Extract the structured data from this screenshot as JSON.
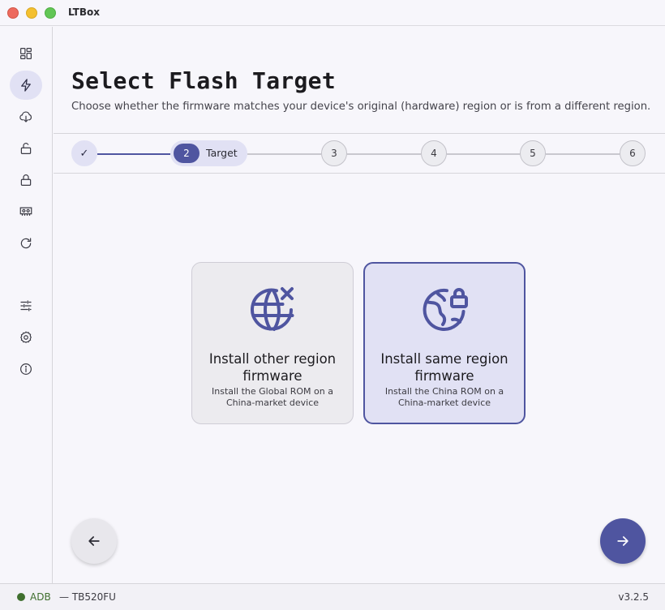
{
  "window": {
    "title": "LTBox"
  },
  "sidebar": {
    "items": [
      {
        "icon": "dashboard-icon",
        "active": false
      },
      {
        "icon": "flash-icon",
        "active": true
      },
      {
        "icon": "cloud-download-icon",
        "active": false
      },
      {
        "icon": "unlock-icon",
        "active": false
      },
      {
        "icon": "lock-icon",
        "active": false
      },
      {
        "icon": "memory-icon",
        "active": false
      },
      {
        "icon": "refresh-icon",
        "active": false
      },
      {
        "icon": "tune-icon",
        "active": false
      },
      {
        "icon": "settings-icon",
        "active": false
      },
      {
        "icon": "info-icon",
        "active": false
      }
    ]
  },
  "page": {
    "title": "Select Flash Target",
    "subtitle": "Choose whether the firmware matches your device's original (hardware) region or is from a different region."
  },
  "stepper": {
    "done_mark": "✓",
    "active_number": "2",
    "active_label": "Target",
    "steps": [
      "3",
      "4",
      "5",
      "6"
    ]
  },
  "options": [
    {
      "title": "Install other region firmware",
      "description": "Install the Global ROM on a China-market device",
      "icon": "globe-x-icon",
      "selected": false
    },
    {
      "title": "Install same region firmware",
      "description": "Install the China ROM on a China-market device",
      "icon": "globe-lock-icon",
      "selected": true
    }
  ],
  "status": {
    "connection": "ADB",
    "device": "— TB520FU",
    "version": "v3.2.5",
    "connection_color": "#3f6f2e"
  },
  "colors": {
    "accent": "#4f55a0",
    "accent_container": "#e1e1f4"
  }
}
